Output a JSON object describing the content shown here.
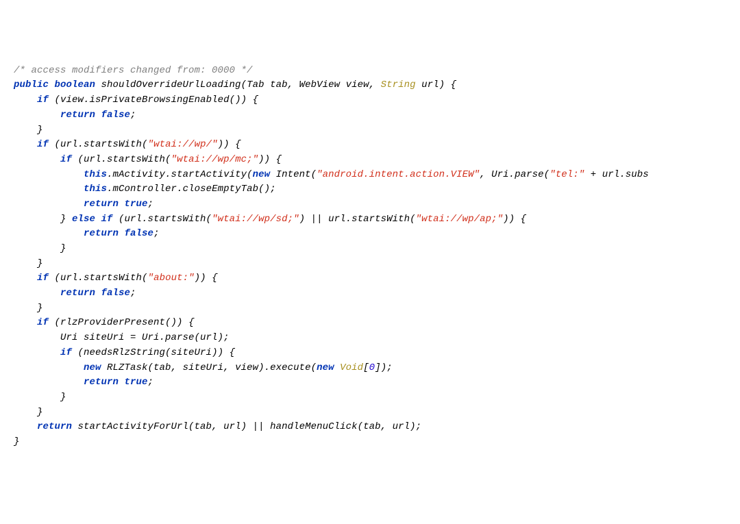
{
  "code": {
    "lines": [
      [
        {
          "t": "/* access modifiers changed from: 0000 */",
          "c": "c-comment"
        }
      ],
      [
        {
          "t": "public ",
          "c": "c-kw"
        },
        {
          "t": "boolean ",
          "c": "c-kw"
        },
        {
          "t": "shouldOverrideUrlLoading(Tab tab, WebView view, ",
          "c": "c-ident"
        },
        {
          "t": "String",
          "c": "c-class"
        },
        {
          "t": " url) {",
          "c": "c-ident"
        }
      ],
      [
        {
          "t": "    ",
          "c": "c-ident"
        },
        {
          "t": "if",
          "c": "c-kw"
        },
        {
          "t": " (view.isPrivateBrowsingEnabled()) {",
          "c": "c-ident"
        }
      ],
      [
        {
          "t": "        ",
          "c": "c-ident"
        },
        {
          "t": "return false",
          "c": "c-kw"
        },
        {
          "t": ";",
          "c": "c-ident"
        }
      ],
      [
        {
          "t": "    }",
          "c": "c-ident"
        }
      ],
      [
        {
          "t": "    ",
          "c": "c-ident"
        },
        {
          "t": "if",
          "c": "c-kw"
        },
        {
          "t": " (url.startsWith(",
          "c": "c-ident"
        },
        {
          "t": "\"wtai://wp/\"",
          "c": "c-str"
        },
        {
          "t": ")) {",
          "c": "c-ident"
        }
      ],
      [
        {
          "t": "        ",
          "c": "c-ident"
        },
        {
          "t": "if",
          "c": "c-kw"
        },
        {
          "t": " (url.startsWith(",
          "c": "c-ident"
        },
        {
          "t": "\"wtai://wp/mc;\"",
          "c": "c-str"
        },
        {
          "t": ")) {",
          "c": "c-ident"
        }
      ],
      [
        {
          "t": "            ",
          "c": "c-ident"
        },
        {
          "t": "this",
          "c": "c-kw"
        },
        {
          "t": ".mActivity.startActivity(",
          "c": "c-ident"
        },
        {
          "t": "new",
          "c": "c-kw"
        },
        {
          "t": " Intent(",
          "c": "c-ident"
        },
        {
          "t": "\"android.intent.action.VIEW\"",
          "c": "c-str"
        },
        {
          "t": ", Uri.parse(",
          "c": "c-ident"
        },
        {
          "t": "\"tel:\"",
          "c": "c-str"
        },
        {
          "t": " + url.subs",
          "c": "c-ident"
        }
      ],
      [
        {
          "t": "            ",
          "c": "c-ident"
        },
        {
          "t": "this",
          "c": "c-kw"
        },
        {
          "t": ".mController.closeEmptyTab();",
          "c": "c-ident"
        }
      ],
      [
        {
          "t": "            ",
          "c": "c-ident"
        },
        {
          "t": "return true",
          "c": "c-kw"
        },
        {
          "t": ";",
          "c": "c-ident"
        }
      ],
      [
        {
          "t": "        } ",
          "c": "c-ident"
        },
        {
          "t": "else if",
          "c": "c-kw"
        },
        {
          "t": " (url.startsWith(",
          "c": "c-ident"
        },
        {
          "t": "\"wtai://wp/sd;\"",
          "c": "c-str"
        },
        {
          "t": ") || url.startsWith(",
          "c": "c-ident"
        },
        {
          "t": "\"wtai://wp/ap;\"",
          "c": "c-str"
        },
        {
          "t": ")) {",
          "c": "c-ident"
        }
      ],
      [
        {
          "t": "            ",
          "c": "c-ident"
        },
        {
          "t": "return false",
          "c": "c-kw"
        },
        {
          "t": ";",
          "c": "c-ident"
        }
      ],
      [
        {
          "t": "        }",
          "c": "c-ident"
        }
      ],
      [
        {
          "t": "    }",
          "c": "c-ident"
        }
      ],
      [
        {
          "t": "    ",
          "c": "c-ident"
        },
        {
          "t": "if",
          "c": "c-kw"
        },
        {
          "t": " (url.startsWith(",
          "c": "c-ident"
        },
        {
          "t": "\"about:\"",
          "c": "c-str"
        },
        {
          "t": ")) {",
          "c": "c-ident"
        }
      ],
      [
        {
          "t": "        ",
          "c": "c-ident"
        },
        {
          "t": "return false",
          "c": "c-kw"
        },
        {
          "t": ";",
          "c": "c-ident"
        }
      ],
      [
        {
          "t": "    }",
          "c": "c-ident"
        }
      ],
      [
        {
          "t": "    ",
          "c": "c-ident"
        },
        {
          "t": "if",
          "c": "c-kw"
        },
        {
          "t": " (rlzProviderPresent()) {",
          "c": "c-ident"
        }
      ],
      [
        {
          "t": "        Uri siteUri = Uri.parse(url);",
          "c": "c-ident"
        }
      ],
      [
        {
          "t": "        ",
          "c": "c-ident"
        },
        {
          "t": "if",
          "c": "c-kw"
        },
        {
          "t": " (needsRlzString(siteUri)) {",
          "c": "c-ident"
        }
      ],
      [
        {
          "t": "            ",
          "c": "c-ident"
        },
        {
          "t": "new",
          "c": "c-kw"
        },
        {
          "t": " RLZTask(tab, siteUri, view).execute(",
          "c": "c-ident"
        },
        {
          "t": "new",
          "c": "c-kw"
        },
        {
          "t": " ",
          "c": "c-ident"
        },
        {
          "t": "Void",
          "c": "c-class"
        },
        {
          "t": "[",
          "c": "c-ident"
        },
        {
          "t": "0",
          "c": "c-num"
        },
        {
          "t": "]);",
          "c": "c-ident"
        }
      ],
      [
        {
          "t": "            ",
          "c": "c-ident"
        },
        {
          "t": "return true",
          "c": "c-kw"
        },
        {
          "t": ";",
          "c": "c-ident"
        }
      ],
      [
        {
          "t": "        }",
          "c": "c-ident"
        }
      ],
      [
        {
          "t": "    }",
          "c": "c-ident"
        }
      ],
      [
        {
          "t": "    ",
          "c": "c-ident"
        },
        {
          "t": "return",
          "c": "c-kw"
        },
        {
          "t": " startActivityForUrl(tab, url) || handleMenuClick(tab, url);",
          "c": "c-ident"
        }
      ],
      [
        {
          "t": "}",
          "c": "c-ident"
        }
      ]
    ]
  }
}
